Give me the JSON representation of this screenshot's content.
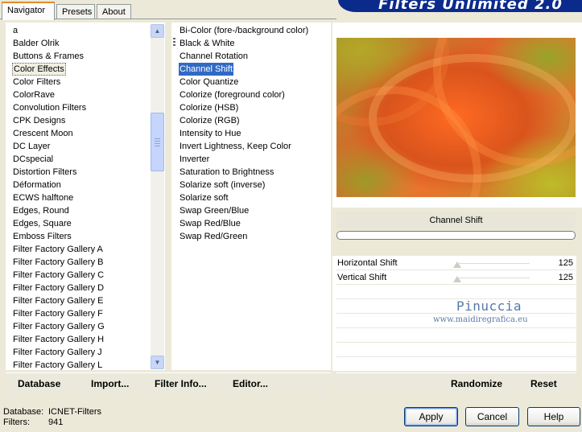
{
  "tabs": [
    {
      "label": "Navigator",
      "active": true
    },
    {
      "label": "Presets",
      "active": false
    },
    {
      "label": "About",
      "active": false
    }
  ],
  "banner": {
    "title": "Filters Unlimited 2.0"
  },
  "categories": {
    "items": [
      "a",
      "Balder Olrik",
      "Buttons & Frames",
      "Color Effects",
      "Color Filters",
      "ColorRave",
      "Convolution Filters",
      "CPK Designs",
      "Crescent Moon",
      "DC Layer",
      "DCspecial",
      "Distortion Filters",
      "Déformation",
      "ECWS halftone",
      "Edges, Round",
      "Edges, Square",
      "Emboss Filters",
      "Filter Factory Gallery A",
      "Filter Factory Gallery B",
      "Filter Factory Gallery C",
      "Filter Factory Gallery D",
      "Filter Factory Gallery E",
      "Filter Factory Gallery F",
      "Filter Factory Gallery G",
      "Filter Factory Gallery H",
      "Filter Factory Gallery J",
      "Filter Factory Gallery L"
    ],
    "selected": "Color Effects"
  },
  "filters": {
    "items": [
      "Bi-Color (fore-/background color)",
      "Black & White",
      "Channel Rotation",
      "Channel Shift",
      "Color Quantize",
      "Colorize (foreground color)",
      "Colorize (HSB)",
      "Colorize (RGB)",
      "Intensity to Hue",
      "Invert Lightness, Keep Color",
      "Inverter",
      "Saturation to Brightness",
      "Solarize soft (inverse)",
      "Solarize soft",
      "Swap Green/Blue",
      "Swap Red/Blue",
      "Swap Red/Green"
    ],
    "selected": "Channel Shift"
  },
  "preview": {
    "filter_name": "Channel Shift"
  },
  "params": [
    {
      "label": "Horizontal Shift",
      "value": "125"
    },
    {
      "label": "Vertical Shift",
      "value": "125"
    }
  ],
  "watermark": {
    "name": "Pinuccia",
    "site": "www.maidiregrafica.eu"
  },
  "toolbar": {
    "database_label": "Database",
    "import_label": "Import...",
    "filter_info_label": "Filter Info...",
    "editor_label": "Editor...",
    "randomize_label": "Randomize",
    "reset_label": "Reset"
  },
  "status": {
    "database_label": "Database:",
    "database_value": "ICNET-Filters",
    "filters_label": "Filters:",
    "filters_value": "941"
  },
  "dialog": {
    "apply_label": "Apply",
    "cancel_label": "Cancel",
    "help_label": "Help"
  },
  "colors": {
    "selection": "#316ac5",
    "banner": "#0a2a8c",
    "face": "#ece9d8"
  }
}
